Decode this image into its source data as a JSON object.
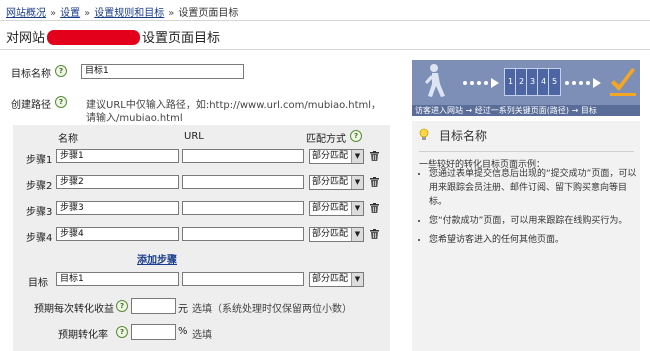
{
  "breadcrumb": {
    "items": [
      "网站概况",
      "设置",
      "设置规则和目标"
    ],
    "current": "设置页面目标",
    "separator": "»"
  },
  "title": {
    "prefix": "对网站",
    "suffix": "设置页面目标"
  },
  "form": {
    "goal_name_label": "目标名称",
    "goal_name_value": "目标1",
    "path_label": "创建路径",
    "path_hint_line1": "建议URL中仅输入路径，如:http://www.url.com/mubiao.html，",
    "path_hint_line2": "请输入/mubiao.html",
    "columns": {
      "name": "名称",
      "url": "URL",
      "match": "匹配方式"
    },
    "steps": [
      {
        "label": "步骤1",
        "name": "步骤1",
        "url": "",
        "match": "部分匹配"
      },
      {
        "label": "步骤2",
        "name": "步骤2",
        "url": "",
        "match": "部分匹配"
      },
      {
        "label": "步骤3",
        "name": "步骤3",
        "url": "",
        "match": "部分匹配"
      },
      {
        "label": "步骤4",
        "name": "步骤4",
        "url": "",
        "match": "部分匹配"
      }
    ],
    "add_step_label": "添加步骤",
    "goal_row": {
      "label": "目标",
      "name": "目标1",
      "url": "",
      "match": "部分匹配"
    },
    "revenue_label": "预期每次转化收益",
    "revenue_value": "",
    "revenue_unit": "元",
    "revenue_note": "选填（系统处理时仅保留两位小数）",
    "rate_label": "预期转化率",
    "rate_value": "",
    "rate_unit": "%",
    "rate_note": "选填"
  },
  "illustration": {
    "step_numbers": [
      "1",
      "2",
      "3",
      "4",
      "5"
    ],
    "caption": "访客进入网站 → 经过一系列关键页面(路径) → 目标"
  },
  "help_panel": {
    "title": "目标名称",
    "intro": "一些较好的转化目标页面示例：",
    "tips": [
      "您通过表单提交信息后出现的“提交成功”页面，可以用来跟踪会员注册、邮件订阅、留下购买意向等目标。",
      "您“付款成功”页面，可以用来跟踪在线购买行为。",
      "您希望访客进入的任何其他页面。"
    ]
  },
  "colors": {
    "link": "#1a3c8c",
    "panel_bg": "#eeeeee",
    "illustration_bg": "#7d8fb6",
    "redaction": "#e2001a",
    "check_orange": "#f5a623"
  }
}
